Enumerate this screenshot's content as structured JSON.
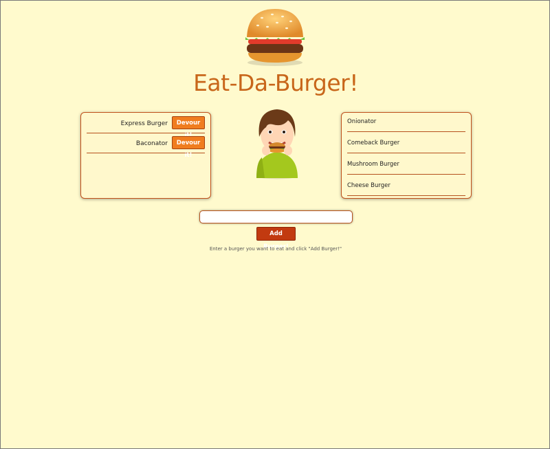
{
  "header": {
    "logo_icon": "hamburger-icon",
    "title": "Eat-Da-Burger!"
  },
  "uneaten": [
    {
      "name": "Express Burger",
      "button": "Devour it!"
    },
    {
      "name": "Baconator",
      "button": "Devour it!"
    }
  ],
  "mascot": {
    "icon": "boy-eating-burger-illustration"
  },
  "eaten": [
    {
      "name": "Onionator"
    },
    {
      "name": "Comeback Burger"
    },
    {
      "name": "Mushroom Burger"
    },
    {
      "name": "Cheese Burger"
    }
  ],
  "form": {
    "input_value": "",
    "input_placeholder": "",
    "add_button": "Add Burger!",
    "hint": "Enter a burger you want to eat and click \"Add Burger!\""
  },
  "colors": {
    "background": "#fffacd",
    "title": "#c8661a",
    "devour_button": "#f07d1f",
    "add_button": "#c23a10",
    "panel_border": "#c0501a"
  }
}
